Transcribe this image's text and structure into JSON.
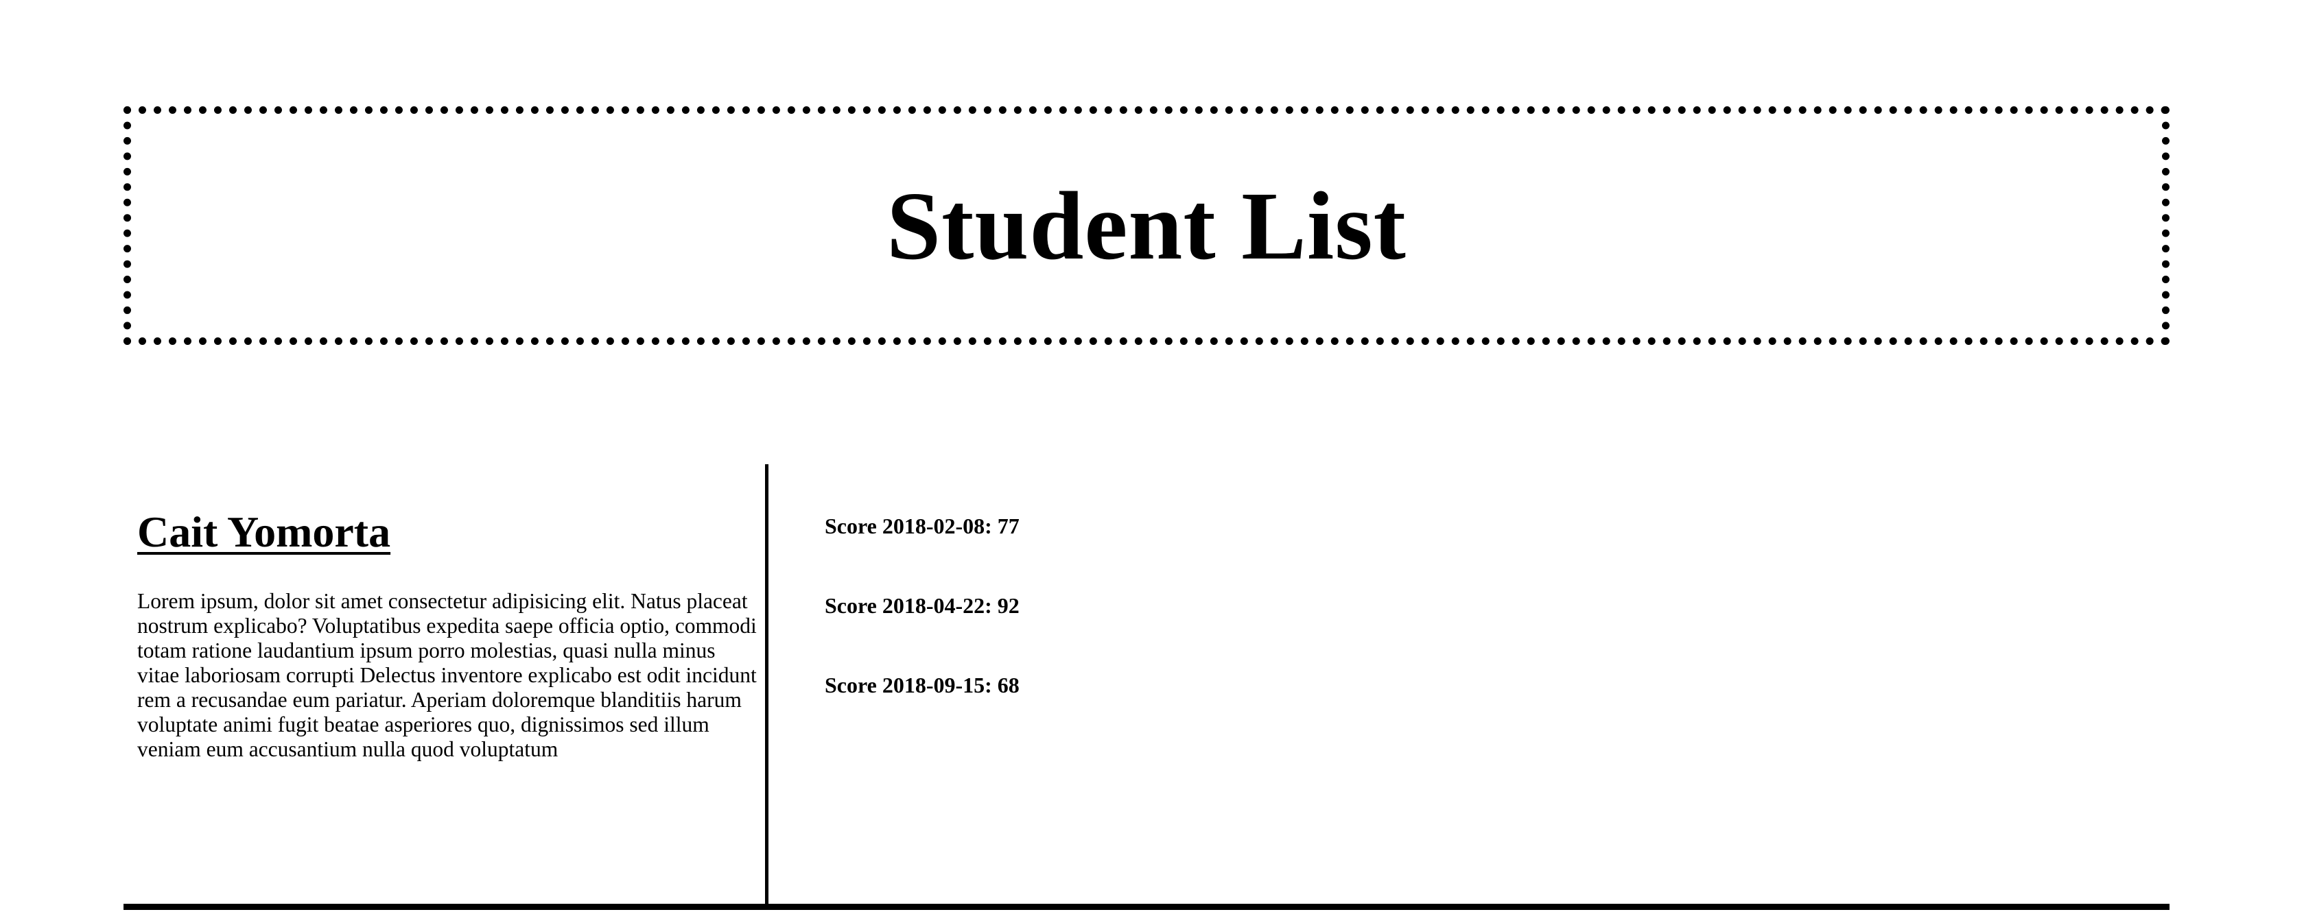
{
  "page": {
    "title": "Student List"
  },
  "student": {
    "name": "Cait Yomorta",
    "bio": "Lorem ipsum, dolor sit amet consectetur adipisicing elit. Natus placeat nostrum explicabo? Voluptatibus expedita saepe officia optio, commodi totam ratione laudantium ipsum porro molestias, quasi nulla minus vitae laboriosam corrupti Delectus inventore explicabo est odit incidunt rem a recusandae eum pariatur. Aperiam doloremque blanditiis harum voluptate animi fugit beatae asperiores quo, dignissimos sed illum veniam eum accusantium nulla quod voluptatum",
    "scores": [
      "Score 2018-02-08: 77",
      "Score 2018-04-22: 92",
      "Score 2018-09-15: 68"
    ]
  }
}
